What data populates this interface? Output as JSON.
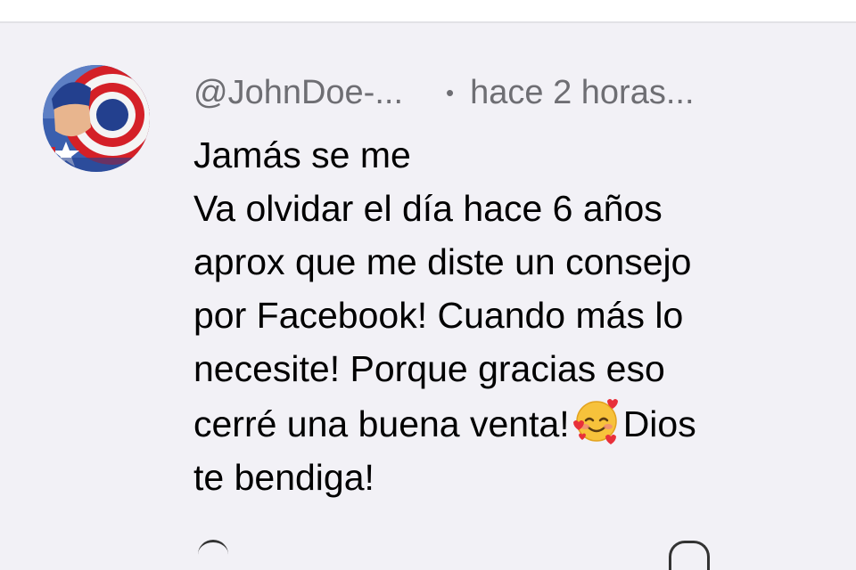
{
  "comment": {
    "author": "@JohnDoe-...",
    "separator": "•",
    "time": "hace 2 horas...",
    "lines": [
      "Jamás se me",
      "Va olvidar el día hace 6 años",
      "aprox que me diste un consejo",
      "por Facebook! Cuando más lo",
      "necesite! Porque gracias eso"
    ],
    "line6_before": "cerré una buena venta!",
    "line6_after": "Dios",
    "line7": "te bendiga!",
    "emoji_name": "smiling-face-with-hearts-icon"
  },
  "actions": {
    "like_icon": "thumbs-up-icon",
    "reply_icon": "reply-icon"
  },
  "colors": {
    "background": "#f2f1f6",
    "meta_text": "#6e6e73",
    "body_text": "#000000"
  }
}
